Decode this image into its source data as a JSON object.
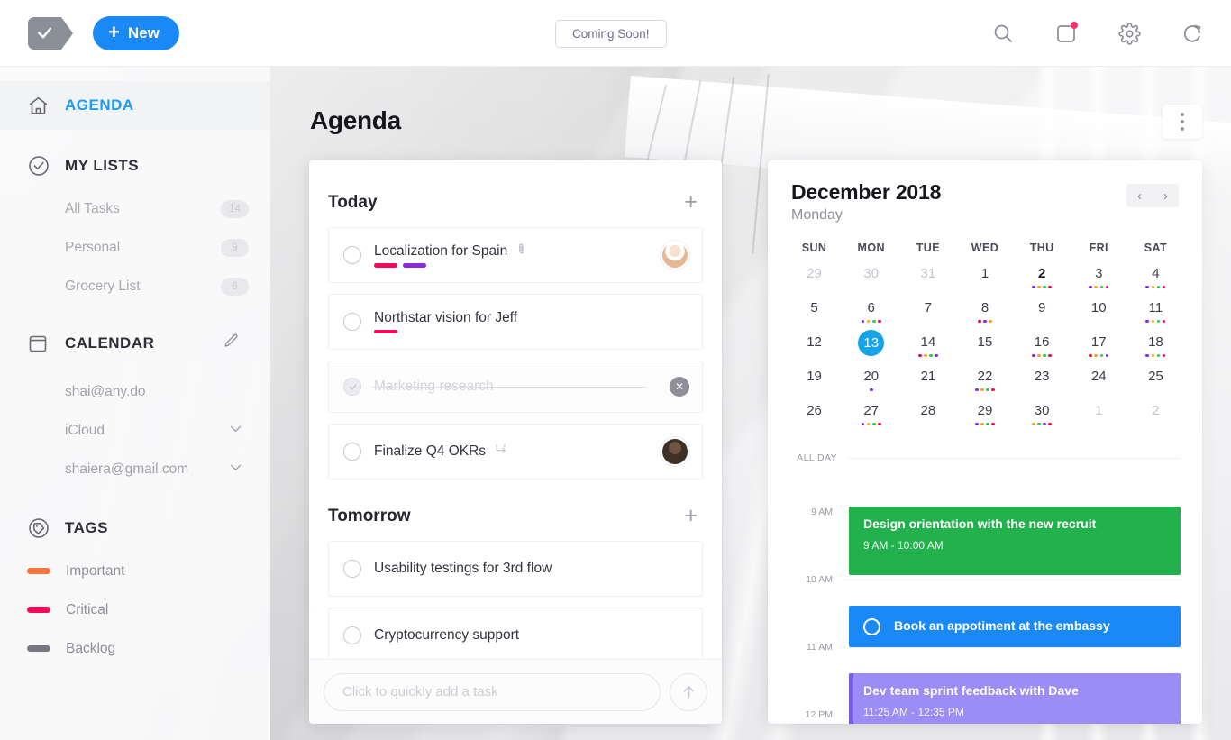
{
  "topbar": {
    "logo_icon": "check-tag-logo",
    "new_label": "New",
    "new_plus": "+",
    "coming_soon_label": "Coming Soon!",
    "icons": [
      "search-icon",
      "notifications-icon",
      "settings-gear-icon",
      "sync-refresh-icon"
    ]
  },
  "sidebar": {
    "agenda": {
      "label": "AGENDA",
      "icon": "home-icon"
    },
    "my_lists": {
      "label": "MY LISTS",
      "icon": "check-circle-icon"
    },
    "lists": [
      {
        "label": "All Tasks",
        "count": "14"
      },
      {
        "label": "Personal",
        "count": "9"
      },
      {
        "label": "Grocery List",
        "count": "6"
      }
    ],
    "calendar": {
      "label": "CALENDAR",
      "icon": "calendar-icon",
      "edit_icon": "pencil-icon"
    },
    "accounts": [
      {
        "label": "shai@any.do",
        "expandable": false
      },
      {
        "label": "iCloud",
        "expandable": true
      },
      {
        "label": "shaiera@gmail.com",
        "expandable": true
      }
    ],
    "tags_header": {
      "label": "TAGS",
      "icon": "tag-icon"
    },
    "tags": [
      {
        "label": "Important",
        "color": "#f9763e"
      },
      {
        "label": "Critical",
        "color": "#f50a5a"
      },
      {
        "label": "Backlog",
        "color": "#77777f"
      }
    ]
  },
  "main": {
    "page_title": "Agenda",
    "more_menu_icon": "more-vertical-icon"
  },
  "tasks": {
    "sections": [
      {
        "title": "Today",
        "add_icon": "plus-icon",
        "items": [
          {
            "text": "Localization for Spain",
            "done": false,
            "attachment_icon": "paperclip-icon",
            "tags": [
              "#f50a5a",
              "#8b2cd9"
            ],
            "avatar": "woman-hat-avatar"
          },
          {
            "text": "Northstar vision for Jeff",
            "done": false,
            "tags": [
              "#f50a5a"
            ]
          },
          {
            "text": "Marketing research",
            "done": true,
            "delete_icon": "close-circle-icon"
          },
          {
            "text": "Finalize Q4 OKRs",
            "done": false,
            "subtask_icon": "subtask-icon",
            "avatar": "man-dark-avatar"
          }
        ]
      },
      {
        "title": "Tomorrow",
        "add_icon": "plus-icon",
        "items": [
          {
            "text": "Usability testings for 3rd flow",
            "done": false
          },
          {
            "text": "Cryptocurrency support",
            "done": false
          }
        ]
      }
    ],
    "quick_add": {
      "placeholder": "Click to quickly add a task",
      "value": "",
      "send_icon": "arrow-up-icon"
    }
  },
  "calendar": {
    "month": "December 2018",
    "weekday": "Monday",
    "prev_icon": "chevron-left-icon",
    "next_icon": "chevron-right-icon",
    "dow": [
      "SUN",
      "MON",
      "TUE",
      "WED",
      "THU",
      "FRI",
      "SAT"
    ],
    "days": [
      {
        "n": "29",
        "muted": true,
        "dots": []
      },
      {
        "n": "30",
        "muted": true,
        "dots": []
      },
      {
        "n": "31",
        "muted": true,
        "dots": []
      },
      {
        "n": "1",
        "dots": []
      },
      {
        "n": "2",
        "bold": true,
        "dots": [
          "#8b2cd9",
          "#f5a623",
          "#35c759",
          "#f50a5a"
        ]
      },
      {
        "n": "3",
        "dots": [
          "#8b2cd9",
          "#f5a623",
          "#35c759",
          "#f50a5a"
        ]
      },
      {
        "n": "4",
        "dots": [
          "#8b2cd9",
          "#f5a623",
          "#35c759",
          "#f50a5a"
        ]
      },
      {
        "n": "5",
        "dots": []
      },
      {
        "n": "6",
        "dots": [
          "#8b2cd9",
          "#f5a623",
          "#35c759",
          "#f50a5a"
        ]
      },
      {
        "n": "7",
        "dots": []
      },
      {
        "n": "8",
        "dots": [
          "#f50a5a",
          "#8b2cd9",
          "#f5a623"
        ]
      },
      {
        "n": "9",
        "dots": []
      },
      {
        "n": "10",
        "dots": []
      },
      {
        "n": "11",
        "dots": [
          "#8b2cd9",
          "#f5a623",
          "#35c759",
          "#f50a5a"
        ]
      },
      {
        "n": "12",
        "dots": []
      },
      {
        "n": "13",
        "today": true,
        "dots": []
      },
      {
        "n": "14",
        "dots": [
          "#f50a5a",
          "#f5a623",
          "#35c759",
          "#8b2cd9"
        ]
      },
      {
        "n": "15",
        "dots": []
      },
      {
        "n": "16",
        "dots": [
          "#8b2cd9",
          "#f5a623",
          "#35c759",
          "#f50a5a"
        ]
      },
      {
        "n": "17",
        "dots": [
          "#f50a5a",
          "#f5a623",
          "#35c759",
          "#8b2cd9"
        ]
      },
      {
        "n": "18",
        "dots": [
          "#8b2cd9",
          "#f5a623",
          "#35c759",
          "#f50a5a"
        ]
      },
      {
        "n": "19",
        "dots": []
      },
      {
        "n": "20",
        "dots": [
          "#8b2cd9"
        ]
      },
      {
        "n": "21",
        "dots": []
      },
      {
        "n": "22",
        "dots": [
          "#8b2cd9",
          "#f5a623",
          "#35c759",
          "#f50a5a"
        ]
      },
      {
        "n": "23",
        "dots": []
      },
      {
        "n": "24",
        "dots": []
      },
      {
        "n": "25",
        "dots": []
      },
      {
        "n": "26",
        "dots": []
      },
      {
        "n": "27",
        "dots": [
          "#8b2cd9",
          "#f5a623",
          "#35c759",
          "#f50a5a"
        ]
      },
      {
        "n": "28",
        "dots": []
      },
      {
        "n": "29",
        "dots": [
          "#8b2cd9",
          "#f5a623",
          "#35c759",
          "#f50a5a"
        ]
      },
      {
        "n": "30",
        "dots": [
          "#f5a623",
          "#35c759",
          "#8b2cd9",
          "#f50a5a"
        ]
      },
      {
        "n": "1",
        "muted": true,
        "dots": []
      },
      {
        "n": "2",
        "muted": true,
        "dots": []
      }
    ],
    "all_day_label": "ALL DAY",
    "hours": [
      "9 AM",
      "10 AM",
      "11 AM",
      "12 PM"
    ],
    "events": [
      {
        "title": "Design orientation with the new recruit",
        "time": "9 AM - 10:00 AM",
        "color": "#22b14c",
        "type": "event"
      },
      {
        "title": "Book an appotiment at the embassy",
        "time": "",
        "color": "#1a88f5",
        "type": "task"
      },
      {
        "title": "Dev team sprint feedback with Dave",
        "time": "11:25 AM - 12:35 PM",
        "color": "#9c8cf5",
        "accent": "#7a5ce8",
        "type": "event"
      }
    ]
  }
}
